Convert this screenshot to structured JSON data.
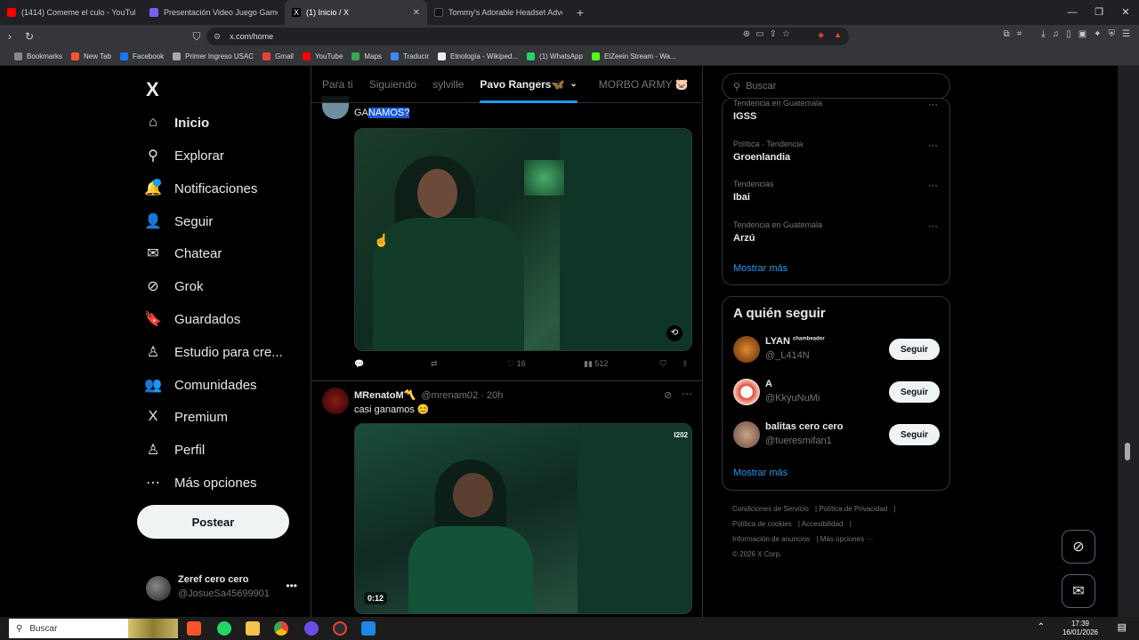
{
  "browser": {
    "tabs": [
      {
        "label": "(1414) Comeme el culo - YouTube",
        "color": "#ff0000"
      },
      {
        "label": "Presentación Video Juego Gamer Vi",
        "color": "#7b5cf5"
      },
      {
        "label": "(1) Inicio / X",
        "color": "#000000",
        "active": true
      },
      {
        "label": "Tommy's Adorable Headset Adventu",
        "color": "#111111"
      }
    ],
    "url": "x.com/home",
    "bookmarks": [
      {
        "label": "Bookmarks",
        "color": "#888888"
      },
      {
        "label": "New Tab",
        "color": "#fb542b"
      },
      {
        "label": "Facebook",
        "color": "#1877f2"
      },
      {
        "label": "Primer Ingreso USAC",
        "color": "#aaaaaa"
      },
      {
        "label": "Gmail",
        "color": "#ea4335"
      },
      {
        "label": "YouTube",
        "color": "#ff0000"
      },
      {
        "label": "Maps",
        "color": "#34a853"
      },
      {
        "label": "Traducir",
        "color": "#4285f4"
      },
      {
        "label": "Etnología - Wikiped...",
        "color": "#eeeeee"
      },
      {
        "label": "(1) WhatsApp",
        "color": "#25d366"
      },
      {
        "label": "ElZeein Stream - Wa...",
        "color": "#53fc18"
      }
    ]
  },
  "nav": {
    "logo": "X",
    "items": [
      {
        "label": "Inicio",
        "icon": "⌂"
      },
      {
        "label": "Explorar",
        "icon": "⚲"
      },
      {
        "label": "Notificaciones",
        "icon": "🔔"
      },
      {
        "label": "Seguir",
        "icon": "👤"
      },
      {
        "label": "Chatear",
        "icon": "✉"
      },
      {
        "label": "Grok",
        "icon": "⊘"
      },
      {
        "label": "Guardados",
        "icon": "🔖"
      },
      {
        "label": "Estudio para cre...",
        "icon": "♙"
      },
      {
        "label": "Comunidades",
        "icon": "👥"
      },
      {
        "label": "Premium",
        "icon": "X"
      },
      {
        "label": "Perfil",
        "icon": "♙"
      },
      {
        "label": "Más opciones",
        "icon": "⋯"
      }
    ],
    "post_label": "Postear",
    "account": {
      "name": "Zeref cero cero",
      "handle": "@JosueSa45699901"
    }
  },
  "feed": {
    "tabs": [
      "Para ti",
      "Siguiendo",
      "sylville",
      "Pavo Rangers🦋",
      "MORBO ARMY 🐷"
    ],
    "tweet1": {
      "text_plain": "GA",
      "text_selected": "NAMOS?",
      "likes": "16",
      "views": "512"
    },
    "tweet2": {
      "name": "MRenatoM〽️",
      "handle": "@mrenam02",
      "time": "· 20h",
      "text": "casi ganamos 😊",
      "duration": "0:12",
      "badge": "I202"
    }
  },
  "right": {
    "search_placeholder": "Buscar",
    "trends": [
      {
        "context": "Tendencia en Guatemala",
        "title": "IGSS"
      },
      {
        "context": "Política · Tendencia",
        "title": "Groenlandia"
      },
      {
        "context": "Tendencias",
        "title": "Ibai"
      },
      {
        "context": "Tendencia en Guatemala",
        "title": "Arzú"
      }
    ],
    "show_more": "Mostrar más",
    "who_title": "A quién seguir",
    "who": [
      {
        "name": "LYAN",
        "tag": "chambeador",
        "handle": "@_L414N",
        "color": "#e38a2b"
      },
      {
        "name": "A",
        "tag": "",
        "handle": "@KkyuNuMi",
        "color": "#e34a3a"
      },
      {
        "name": "balitas cero cero",
        "tag": "",
        "handle": "@tueresmifan1",
        "color": "#c9a38a"
      }
    ],
    "follow_label": "Seguir",
    "footer": [
      "Condiciones de Servicio",
      "Política de Privacidad",
      "Política de cookies",
      "Accesibilidad",
      "Información de anuncios",
      "Más opciones ···",
      "© 2026 X Corp."
    ]
  },
  "taskbar": {
    "search": "Buscar",
    "time": "17:39",
    "date": "16/01/2026"
  }
}
